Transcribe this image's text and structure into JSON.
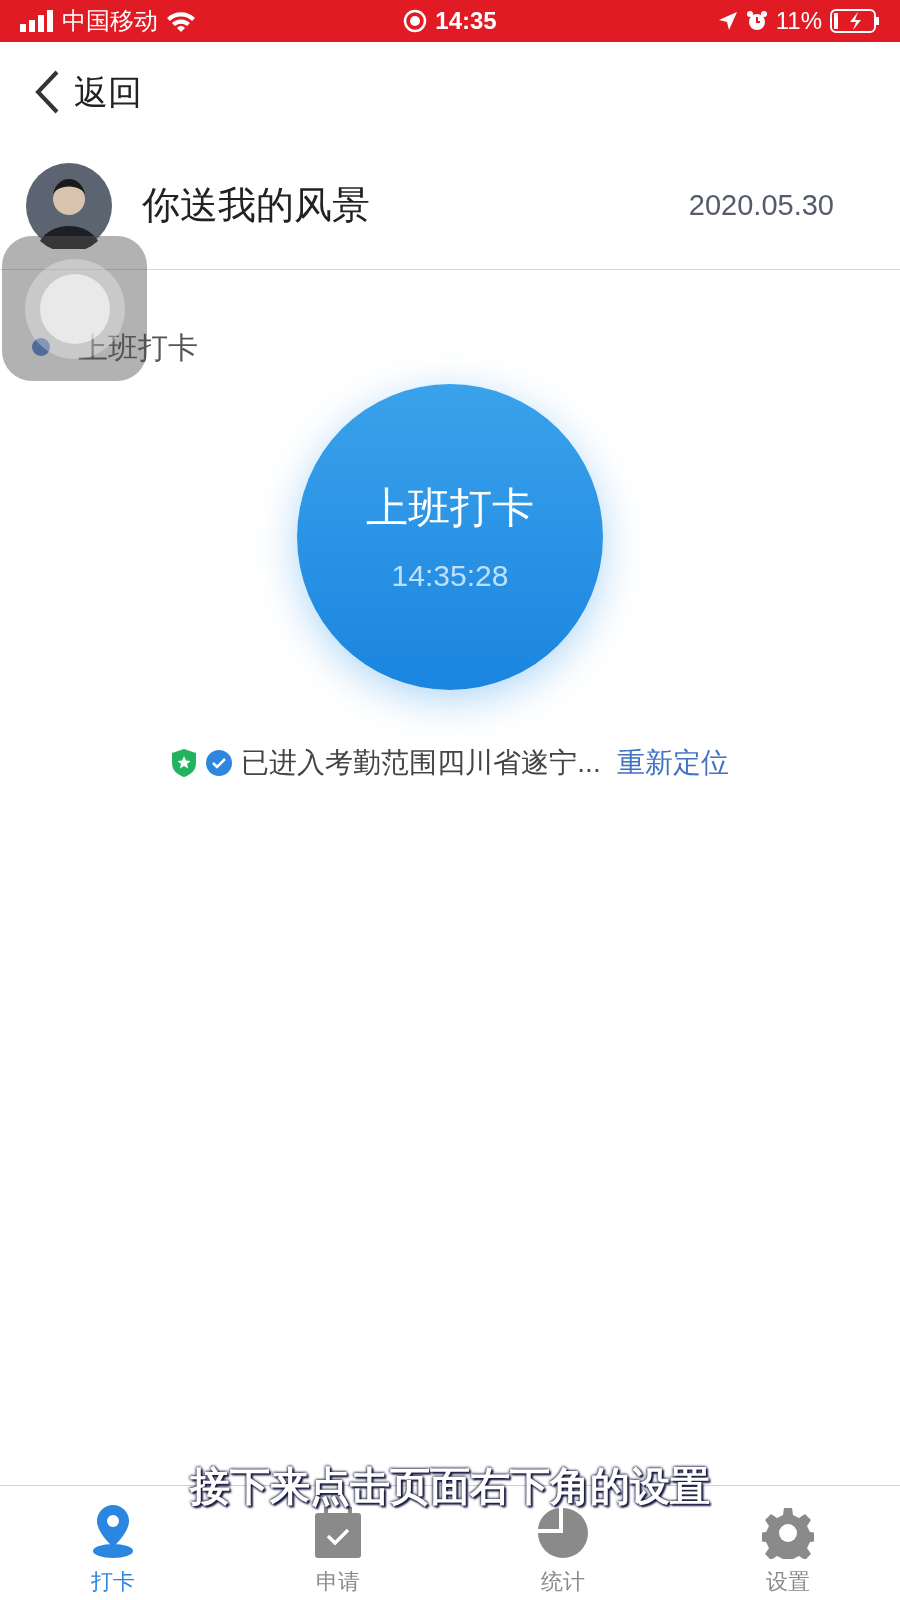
{
  "status_bar": {
    "carrier": "中国移动",
    "time": "14:35",
    "battery": "11%"
  },
  "nav": {
    "back": "返回"
  },
  "profile": {
    "name": "你送我的风景",
    "date": "2020.05.30"
  },
  "punch": {
    "section_label": "上班打卡",
    "button_label": "上班打卡",
    "time": "14:35:28"
  },
  "location": {
    "status": "已进入考勤范围四川省遂宁...",
    "action": "重新定位"
  },
  "tabs": [
    {
      "kind": "pin",
      "label": "打卡",
      "selected": true
    },
    {
      "kind": "calendar",
      "label": "申请",
      "selected": false
    },
    {
      "kind": "pie",
      "label": "统计",
      "selected": false
    },
    {
      "kind": "gear",
      "label": "设置",
      "selected": false
    }
  ],
  "caption": "接下来点击页面右下角的设置"
}
